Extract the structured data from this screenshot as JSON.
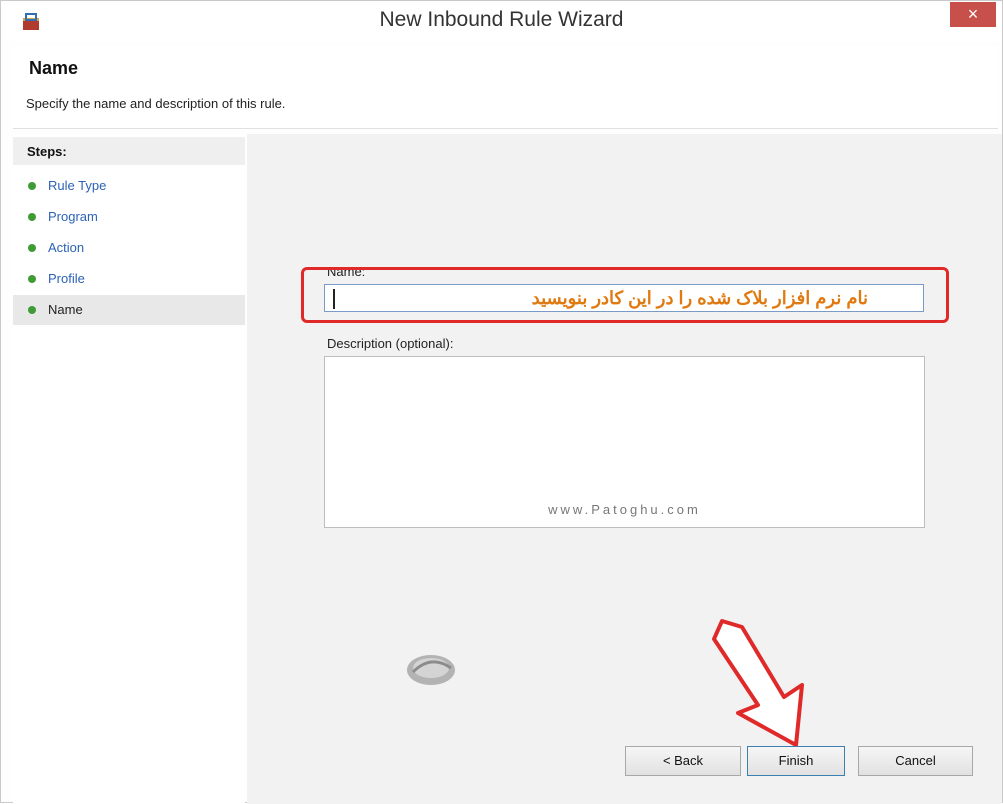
{
  "window": {
    "title": "New Inbound Rule Wizard",
    "close_glyph": "×"
  },
  "header": {
    "title": "Name",
    "description": "Specify the name and description of this rule."
  },
  "steps": {
    "heading": "Steps:",
    "items": [
      {
        "label": "Rule Type"
      },
      {
        "label": "Program"
      },
      {
        "label": "Action"
      },
      {
        "label": "Profile"
      },
      {
        "label": "Name"
      }
    ],
    "current_index": 4
  },
  "form": {
    "name_label": "Name:",
    "name_value": "نام نرم افزار بلاک شده را در این کادر بنویسید",
    "description_label": "Description (optional):",
    "description_value": "",
    "watermark": "www.Patoghu.com"
  },
  "buttons": {
    "back": "< Back",
    "finish": "Finish",
    "cancel": "Cancel"
  },
  "colors": {
    "accent_highlight": "#e02a2a",
    "step_link": "#2c62b5",
    "step_dot": "#3f9b35",
    "annotation_text": "#e07a10"
  }
}
